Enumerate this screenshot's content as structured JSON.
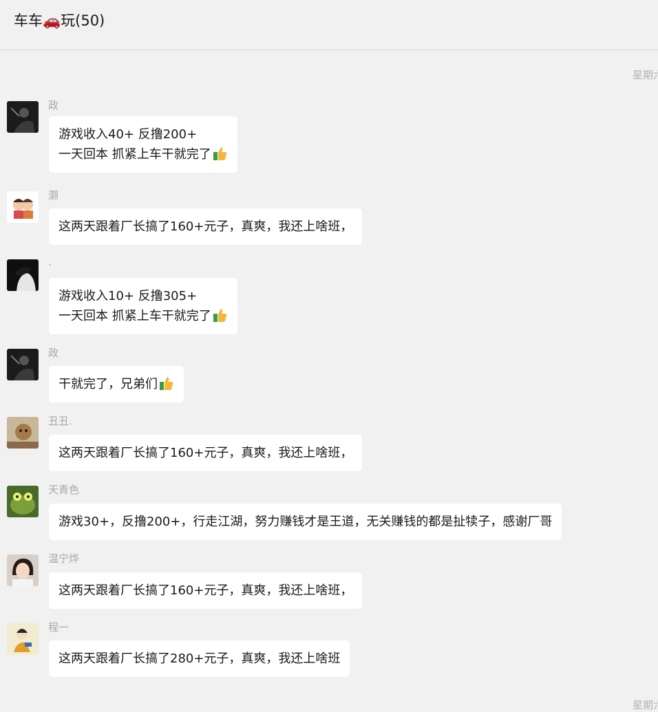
{
  "header": {
    "title": "车车🚗玩(50)"
  },
  "date_separators": {
    "top": "星期六",
    "bottom": "星期六"
  },
  "messages": [
    {
      "sender": "政",
      "line1": "游戏收入40+ 反撸200+",
      "line2": "一天回本 抓紧上车干就完了",
      "thumb": "thumbs-up-icon"
    },
    {
      "sender": "灏",
      "line1": "这两天跟着厂长搞了160+元子，真爽，我还上啥班，"
    },
    {
      "sender": ".",
      "line1": "游戏收入10+ 反撸305+",
      "line2": "一天回本 抓紧上车干就完了",
      "thumb": "thumbs-up-icon"
    },
    {
      "sender": "政",
      "line1": "干就完了，兄弟们",
      "thumb": "thumbs-up-icon"
    },
    {
      "sender": "丑丑.",
      "line1": "这两天跟着厂长搞了160+元子，真爽，我还上啥班，"
    },
    {
      "sender": "天青色",
      "line1": "游戏30+，反撸200+，行走江湖，努力赚钱才是王道，无关赚钱的都是扯犊子，感谢厂哥"
    },
    {
      "sender": "温宁烨",
      "line1": "这两天跟着厂长搞了160+元子，真爽，我还上啥班，"
    },
    {
      "sender": "程一",
      "line1": "这两天跟着厂长搞了280+元子，真爽，我还上啥班"
    }
  ]
}
